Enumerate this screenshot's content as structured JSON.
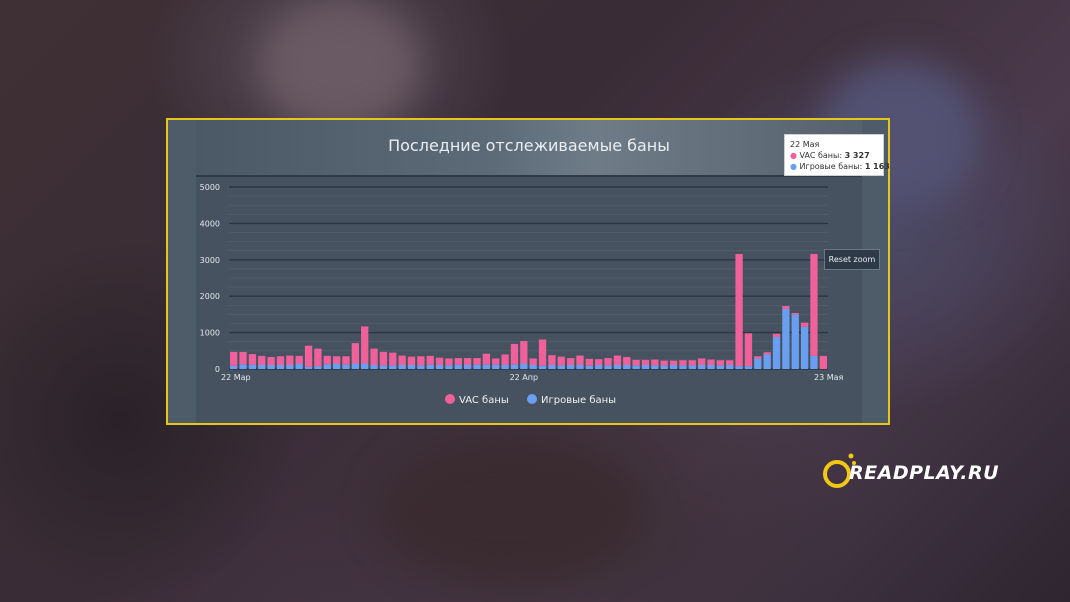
{
  "title": "Последние отслеживаемые баны",
  "tooltip": {
    "date": "22 Мая",
    "vac_label": "VAC баны:",
    "vac_value": "3 327",
    "game_label": "Игровые баны:",
    "game_value": "1 163"
  },
  "reset_zoom_label": "Reset zoom",
  "logo_text": "READPLAY.RU",
  "colors": {
    "vac": "#f0609a",
    "game": "#6a9ef0",
    "frame": "#e6c619"
  },
  "chart_data": {
    "type": "bar",
    "stacked": true,
    "title": "Последние отслеживаемые баны",
    "x_tick_labels": [
      "22 Мар",
      "22 Апр",
      "23 Мая"
    ],
    "y_ticks": [
      0,
      1000,
      2000,
      3000,
      4000,
      5000
    ],
    "ylim": [
      0,
      5000
    ],
    "grid": true,
    "legend_position": "bottom-center",
    "series": [
      {
        "name": "VAC баны",
        "values": [
          380,
          340,
          290,
          250,
          220,
          240,
          260,
          210,
          580,
          480,
          230,
          200,
          230,
          560,
          1020,
          450,
          370,
          350,
          260,
          230,
          250,
          240,
          200,
          190,
          180,
          190,
          180,
          300,
          170,
          290,
          570,
          620,
          180,
          720,
          270,
          240,
          190,
          260,
          190,
          160,
          200,
          260,
          220,
          150,
          140,
          160,
          130,
          120,
          140,
          140,
          180,
          150,
          140,
          130,
          3080,
          900,
          60,
          60,
          90,
          80,
          40,
          110,
          2800,
          360
        ]
      },
      {
        "name": "Игровые баны",
        "values": [
          90,
          130,
          120,
          110,
          110,
          110,
          110,
          150,
          60,
          80,
          130,
          150,
          120,
          150,
          150,
          110,
          100,
          100,
          110,
          110,
          100,
          120,
          110,
          100,
          120,
          110,
          120,
          120,
          120,
          110,
          120,
          150,
          110,
          90,
          110,
          100,
          110,
          110,
          90,
          110,
          100,
          110,
          110,
          100,
          110,
          100,
          100,
          110,
          100,
          100,
          110,
          110,
          100,
          110,
          80,
          80,
          290,
          400,
          880,
          1650,
          1500,
          1163,
          360,
          0
        ]
      }
    ]
  }
}
